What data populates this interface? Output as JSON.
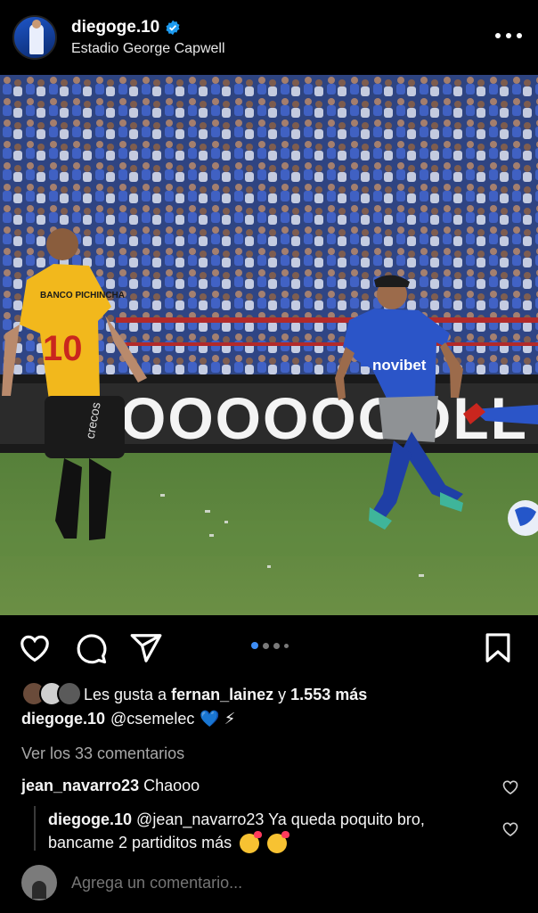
{
  "header": {
    "username": "diegoge.10",
    "location": "Estadio George Capwell"
  },
  "photo": {
    "banner_text": "OOOOOOOLL",
    "sponsor_text": "novibet",
    "opponent_shirt_text": "BANCO PICHINCHA",
    "opponent_number": "10",
    "shorts_text": "crecos"
  },
  "carousel": {
    "count": 4,
    "active": 0
  },
  "likes": {
    "prefix": "Les gusta a",
    "user": "fernan_lainez",
    "connector": "y",
    "count": "1.553 más"
  },
  "caption": {
    "user": "diegoge.10",
    "text": "@csemelec",
    "emoji": "💙 ⚡"
  },
  "view_comments": "Ver los 33 comentarios",
  "comments": [
    {
      "user": "jean_navarro23",
      "text": "Chaooo"
    },
    {
      "user": "diegoge.10",
      "text": "@jean_navarro23 Ya queda poquito bro, bancame 2 partiditos más"
    }
  ],
  "add_comment": {
    "placeholder": "Agrega un comentario..."
  },
  "colors": {
    "accent": "#3d8df5",
    "verified": "#1d9bf0",
    "background": "#000000"
  }
}
